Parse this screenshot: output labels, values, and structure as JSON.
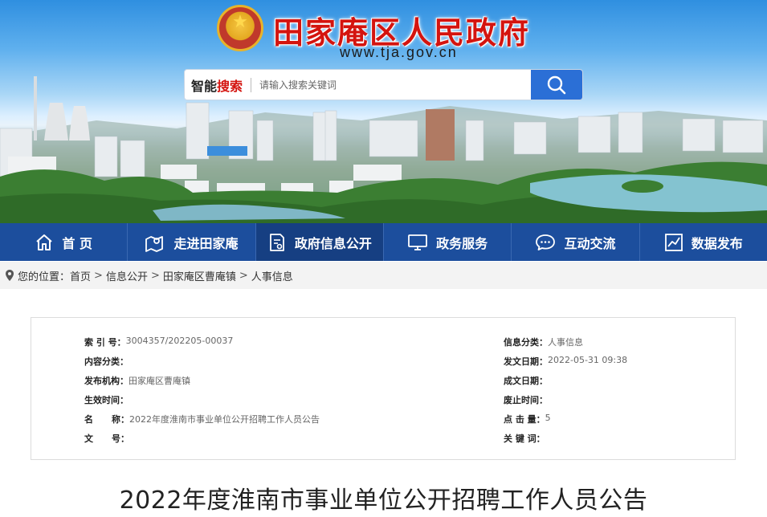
{
  "header": {
    "site_title": "田家庵区人民政府",
    "site_url": "www.tja.gov.cn"
  },
  "search": {
    "label_part1": "智能",
    "label_part2": "搜索",
    "placeholder": "请输入搜索关键词",
    "button_icon": "search-icon"
  },
  "colors": {
    "nav_bg": "#1c4e9d",
    "title_red": "#d4140f",
    "search_button": "#2b6fd6"
  },
  "nav": {
    "items": [
      {
        "label": "首 页",
        "icon": "home-icon"
      },
      {
        "label": "走进田家庵",
        "icon": "map-pin-icon"
      },
      {
        "label": "政府信息公开",
        "icon": "document-icon"
      },
      {
        "label": "政务服务",
        "icon": "monitor-icon"
      },
      {
        "label": "互动交流",
        "icon": "chat-icon"
      },
      {
        "label": "数据发布",
        "icon": "chart-icon"
      }
    ]
  },
  "breadcrumb": {
    "prefix": "您的位置：",
    "items": [
      "首页",
      "信息公开",
      "田家庵区曹庵镇",
      "人事信息"
    ],
    "separator": ">"
  },
  "info": {
    "left": [
      {
        "key": "索 引 号：",
        "value": "3004357/202205-00037"
      },
      {
        "key": "内容分类：",
        "value": ""
      },
      {
        "key": "发布机构：",
        "value": "田家庵区曹庵镇"
      },
      {
        "key": "生效时间：",
        "value": ""
      },
      {
        "key": "名      称：",
        "value": "2022年度淮南市事业单位公开招聘工作人员公告"
      },
      {
        "key": "文      号：",
        "value": ""
      }
    ],
    "right": [
      {
        "key": "信息分类：",
        "value": "人事信息"
      },
      {
        "key": "发文日期：",
        "value": "2022-05-31 09:38"
      },
      {
        "key": "成文日期：",
        "value": ""
      },
      {
        "key": "废止时间：",
        "value": ""
      },
      {
        "key": "点 击 量：",
        "value": "5"
      },
      {
        "key": "关 键 词：",
        "value": ""
      }
    ]
  },
  "article": {
    "title": "2022年度淮南市事业单位公开招聘工作人员公告"
  }
}
